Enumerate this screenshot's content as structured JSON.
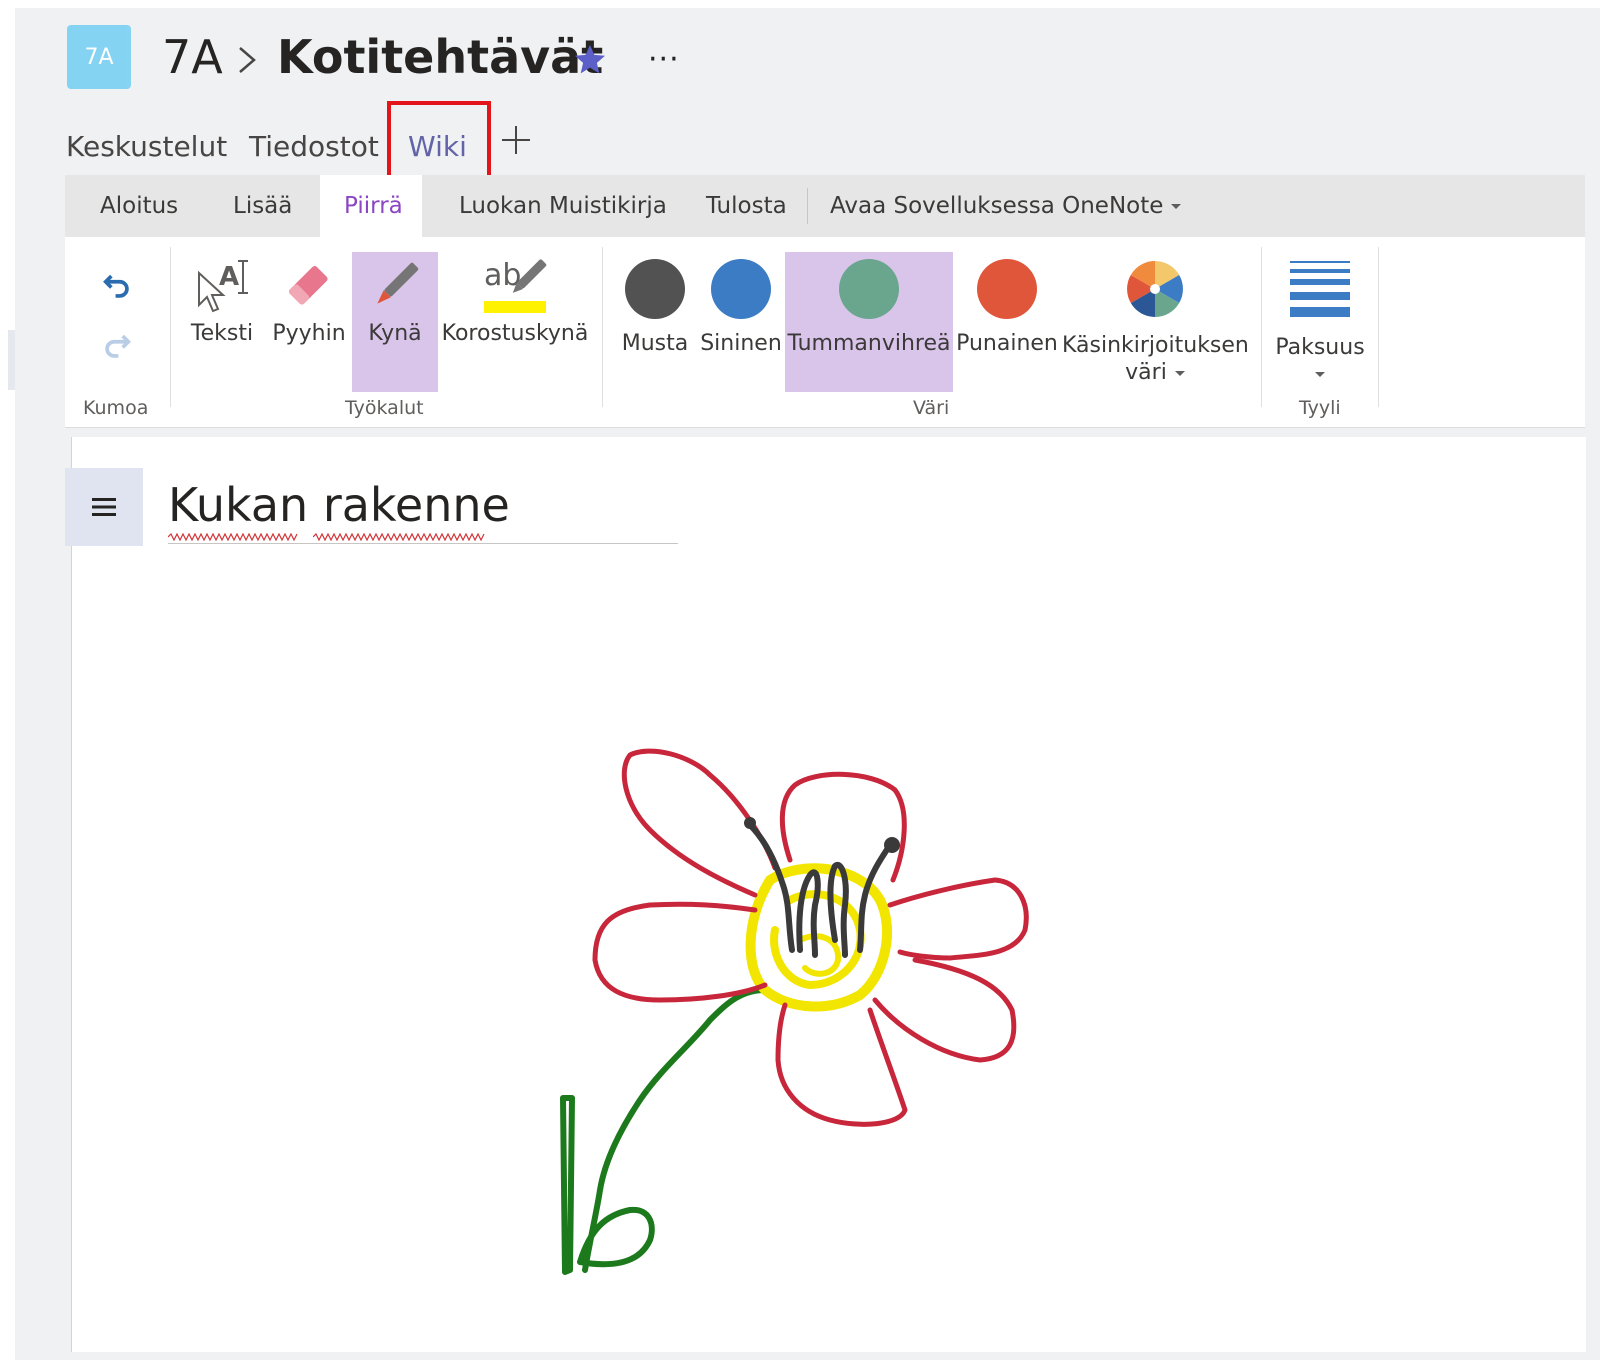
{
  "header": {
    "team_avatar": "7A",
    "team": "7A",
    "channel": "Kotitehtävät",
    "more": "···"
  },
  "tabs": [
    {
      "label": "Keskustelut"
    },
    {
      "label": "Tiedostot"
    },
    {
      "label": "Wiki"
    }
  ],
  "ribbon": {
    "tabs": [
      "Aloitus",
      "Lisää",
      "Piirrä",
      "Luokan Muistikirja",
      "Tulosta",
      "Avaa Sovelluksessa OneNote"
    ],
    "active_tab": "Piirrä",
    "tools": [
      "Teksti",
      "Pyyhin",
      "Kynä",
      "Korostuskynä"
    ],
    "colors": [
      {
        "label": "Musta",
        "color": "#525252"
      },
      {
        "label": "Sininen",
        "color": "#3c7cc4"
      },
      {
        "label": "Tummanvihreä",
        "color": "#6aa68e"
      },
      {
        "label": "Punainen",
        "color": "#e0563a"
      }
    ],
    "ink_color_label_1": "Käsinkirjoituksen",
    "ink_color_label_2": "väri",
    "thickness": "Paksuus",
    "groups": {
      "undo": "Kumoa",
      "tools": "Työkalut",
      "color": "Väri",
      "style": "Tyyli"
    },
    "accent": "#8b46c4"
  },
  "page": {
    "title": "Kukan rakenne"
  }
}
